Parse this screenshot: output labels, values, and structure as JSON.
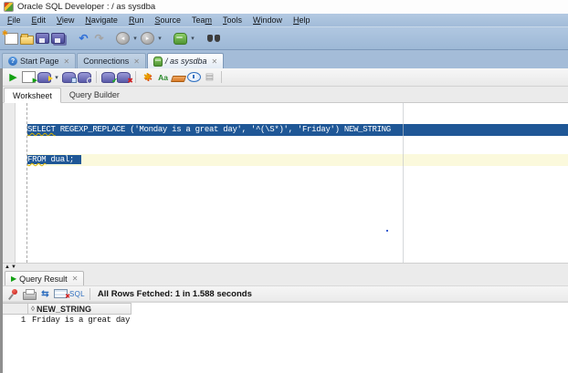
{
  "window": {
    "title": "Oracle SQL Developer : / as sysdba"
  },
  "menu": {
    "items": [
      {
        "name": "file",
        "pre": "",
        "mn": "F",
        "post": "ile"
      },
      {
        "name": "edit",
        "pre": "",
        "mn": "E",
        "post": "dit"
      },
      {
        "name": "view",
        "pre": "",
        "mn": "V",
        "post": "iew"
      },
      {
        "name": "navigate",
        "pre": "",
        "mn": "N",
        "post": "avigate"
      },
      {
        "name": "run",
        "pre": "",
        "mn": "R",
        "post": "un"
      },
      {
        "name": "source",
        "pre": "",
        "mn": "S",
        "post": "ource"
      },
      {
        "name": "team",
        "pre": "Tea",
        "mn": "m",
        "post": ""
      },
      {
        "name": "tools",
        "pre": "",
        "mn": "T",
        "post": "ools"
      },
      {
        "name": "window",
        "pre": "",
        "mn": "W",
        "post": "indow"
      },
      {
        "name": "help",
        "pre": "",
        "mn": "H",
        "post": "elp"
      }
    ]
  },
  "main_toolbar": [
    {
      "name": "new-file-icon"
    },
    {
      "name": "open-folder-icon"
    },
    {
      "name": "save-icon"
    },
    {
      "name": "save-all-icon"
    },
    {
      "name": "gap"
    },
    {
      "name": "undo-icon",
      "glyph": "↶"
    },
    {
      "name": "redo-icon",
      "glyph": "↷"
    },
    {
      "name": "gap"
    },
    {
      "name": "nav-back-icon",
      "glyph": "◂"
    },
    {
      "name": "dropdown-icon",
      "glyph": "▾"
    },
    {
      "name": "nav-forward-icon",
      "glyph": "▸"
    },
    {
      "name": "dropdown-icon",
      "glyph": "▾"
    },
    {
      "name": "gap"
    },
    {
      "name": "connections-icon"
    },
    {
      "name": "dropdown-icon",
      "glyph": "▾"
    },
    {
      "name": "gap"
    },
    {
      "name": "find-icon"
    }
  ],
  "worksheet_toolbar": [
    {
      "name": "run-statement-icon",
      "glyph": "▶"
    },
    {
      "name": "run-script-icon"
    },
    {
      "name": "autotrace-icon"
    },
    {
      "name": "dropdown-icon",
      "glyph": "▾"
    },
    {
      "name": "explain-plan-icon"
    },
    {
      "name": "tuning-advisor-icon"
    },
    {
      "name": "separator"
    },
    {
      "name": "commit-icon"
    },
    {
      "name": "rollback-icon"
    },
    {
      "name": "separator"
    },
    {
      "name": "unshared-worksheet-icon",
      "glyph": "✱"
    },
    {
      "name": "case-toggle-icon",
      "glyph": "Aa"
    },
    {
      "name": "clear-icon"
    },
    {
      "name": "history-icon"
    },
    {
      "name": "disabled-tool-icon",
      "glyph": "▤"
    },
    {
      "name": "separator"
    }
  ],
  "qr_toolbar_icons": [
    {
      "name": "pin-icon"
    },
    {
      "name": "print-icon"
    },
    {
      "name": "fetch-icon",
      "glyph": "⇆"
    },
    {
      "name": "delete-grid-icon"
    },
    {
      "name": "sql-label-icon",
      "glyph": "SQL"
    },
    {
      "name": "separator"
    }
  ],
  "doc_tabs": [
    {
      "name": "start-page",
      "label": "Start Page",
      "icon": "help-icon",
      "icon_glyph": "?",
      "active": false,
      "italic": false
    },
    {
      "name": "connections",
      "label": "Connections",
      "icon": null,
      "active": false,
      "italic": false
    },
    {
      "name": "as-sysdba",
      "label": "/ as sysdba",
      "icon": "db-green-icon",
      "active": true,
      "italic": true
    }
  ],
  "ws_tabs": {
    "worksheet": "Worksheet",
    "query_builder": "Query Builder"
  },
  "editor": {
    "line1": {
      "kw": "SELECT",
      "rest": " REGEXP_REPLACE ('Monday is a great day', '^(\\S*)', 'Friday') NEW_STRING"
    },
    "line2": {
      "kw": "FROM",
      "rest": " dual;"
    }
  },
  "qr": {
    "tab_label": "Query Result",
    "play_glyph": "▶",
    "status": "All Rows Fetched: 1 in 1.588 seconds"
  },
  "grid": {
    "sort_glyph": "◊",
    "header": "NEW_STRING",
    "rows": [
      {
        "num": "1",
        "value": "Friday is a great day"
      }
    ]
  },
  "colors": {
    "toolbar_blue": "#a9c1dc",
    "selection_blue": "#1f5796",
    "current_line_yellow": "#fbf9dc",
    "run_green": "#12a012",
    "panel_gray": "#ebebeb"
  }
}
